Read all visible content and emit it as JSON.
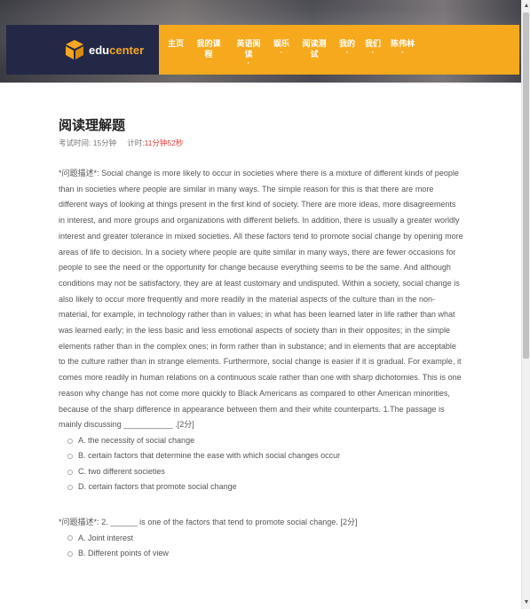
{
  "brand": {
    "name_part1": "edu",
    "name_part2": "center"
  },
  "nav": {
    "items": [
      {
        "label": "主页",
        "extra": ""
      },
      {
        "label": "我的课程",
        "extra": ""
      },
      {
        "label": "英语阅读",
        "extra": "·"
      },
      {
        "label": "娱乐",
        "extra": "·"
      },
      {
        "label": "阅读测试",
        "extra": ""
      },
      {
        "label": "我的",
        "extra": "·"
      },
      {
        "label": "我们",
        "extra": "·"
      },
      {
        "label": "陈伟林",
        "extra": "·"
      }
    ]
  },
  "exam": {
    "title": "阅读理解题",
    "duration": "考试时间: 15分钟",
    "timer_label": "计时:",
    "timer_value": "11分钟52秒"
  },
  "questions": [
    {
      "text": "*问题描述*: Social change is more likely to occur in societies where there is a mixture of different kinds of people than in societies where people are similar in many ways. The simple reason for this is that there are more different ways of looking at things present in the first kind of society. There are more ideas, more disagreements in interest, and more groups and organizations with different beliefs. In addition, there is      usually a greater worldly interest and greater tolerance in mixed societies. All these factors tend to promote social change by opening more areas of life to decision. In a society where people are quite similar in many ways, there are fewer occasions for people to see the need or the opportunity for change because everything seems to be the same. And although conditions may not be satisfactory, they are at least customary and undisputed.      Within a society, social change is also likely to occur more frequently and more readily in the material aspects of the culture than in the non-material, for example, in technology rather than in values; in what has been learned later in life rather than what was learned early; in the less basic and less emotional aspects of society than in their opposites; in the simple elements rather than in the complex ones; in form rather than in substance; and in elements that are acceptable to the culture rather than in strange elements.      Furthermore, social change is easier if it is gradual. For example, it comes more readily in human relations on a continuous scale rather than one with sharp dichotomies. This is one reason why change has not come more quickly to Black Americans as compared to other American minorities, because of the sharp difference in appearance between them and their white counterparts.      1.The passage is mainly discussing ___________ .[2分]",
      "options": [
        "A. the necessity of social change",
        "B. certain factors that determine the ease with which social changes occur",
        "C. two different societies",
        "D. certain factors that promote social change"
      ]
    },
    {
      "text": "*问题描述*: 2. ______ is one of the factors that tend to promote social change. [2分]",
      "options": [
        "A. Joint interest",
        "B. Different points of view"
      ]
    }
  ]
}
